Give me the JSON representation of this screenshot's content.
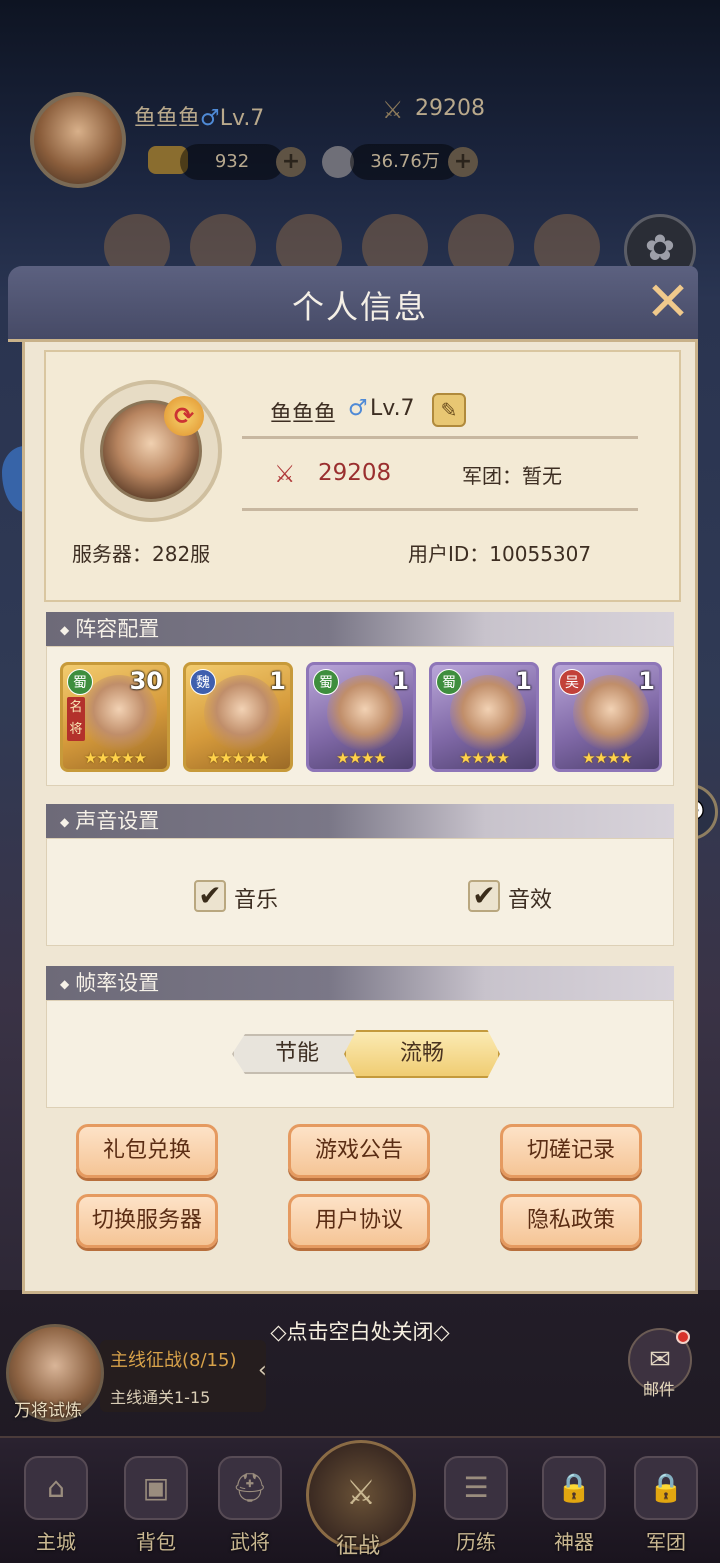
{
  "topbar": {
    "player_name": "鱼鱼鱼",
    "gender_symbol": "♂",
    "level": "Lv.7",
    "power": "29208",
    "gold": "932",
    "coins": "36.76万"
  },
  "modal": {
    "title": "个人信息",
    "close_symbol": "✕",
    "profile": {
      "name": "鱼鱼鱼",
      "gender_symbol": "♂",
      "level": "Lv.7",
      "power": "29208",
      "corps": "军团：暂无",
      "server": "服务器：282服",
      "user_id": "用户ID：10055307"
    },
    "lineup": {
      "title": "阵容配置",
      "heroes": [
        {
          "faction": "蜀",
          "level": "30",
          "stars": "★★★★★",
          "famous": "名将"
        },
        {
          "faction": "魏",
          "level": "1",
          "stars": "★★★★★"
        },
        {
          "faction": "蜀",
          "level": "1",
          "stars": "★★★★"
        },
        {
          "faction": "蜀",
          "level": "1",
          "stars": "★★★★"
        },
        {
          "faction": "吴",
          "level": "1",
          "stars": "★★★★"
        }
      ]
    },
    "sound": {
      "title": "声音设置",
      "music_label": "音乐",
      "sfx_label": "音效",
      "music_checked": true,
      "sfx_checked": true
    },
    "framerate": {
      "title": "帧率设置",
      "option_power_save": "节能",
      "option_smooth": "流畅",
      "selected": "流畅"
    },
    "buttons": {
      "gift_redeem": "礼包兑换",
      "announcement": "游戏公告",
      "duel_records": "切磋记录",
      "switch_server": "切换服务器",
      "user_agreement": "用户协议",
      "privacy_policy": "隐私政策"
    }
  },
  "close_hint": "◇点击空白处关闭◇",
  "quest": {
    "avatar_label": "万将试炼",
    "title": "主线征战(8/15)",
    "subtitle": "主线通关1-15"
  },
  "mail_label": "邮件",
  "nav": {
    "main_city": "主城",
    "backpack": "背包",
    "generals": "武将",
    "battle": "征战",
    "training": "历练",
    "artifact": "神器",
    "corps": "军团"
  },
  "colors": {
    "modal_bg": "#efe6d3",
    "header_bg": "#464a66",
    "power_red": "#9a2f2f",
    "button_orange": "#f5c596"
  }
}
